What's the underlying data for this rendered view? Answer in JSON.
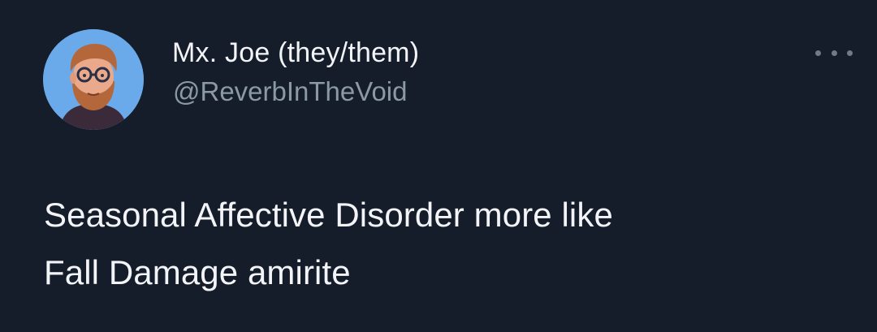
{
  "author": {
    "display_name": "Mx. Joe (they/them)",
    "handle": "@ReverbInTheVoid",
    "avatar_icon": "cartoon-portrait-avatar"
  },
  "menu": {
    "icon": "more-options-icon"
  },
  "tweet": {
    "lines": [
      "Seasonal Affective Disorder more like",
      "Fall Damage amirite"
    ]
  },
  "colors": {
    "background": "#151c2a",
    "text_primary": "#f2f4f7",
    "text_secondary": "#8b98a5",
    "avatar_bg": "#6aa9ea"
  }
}
